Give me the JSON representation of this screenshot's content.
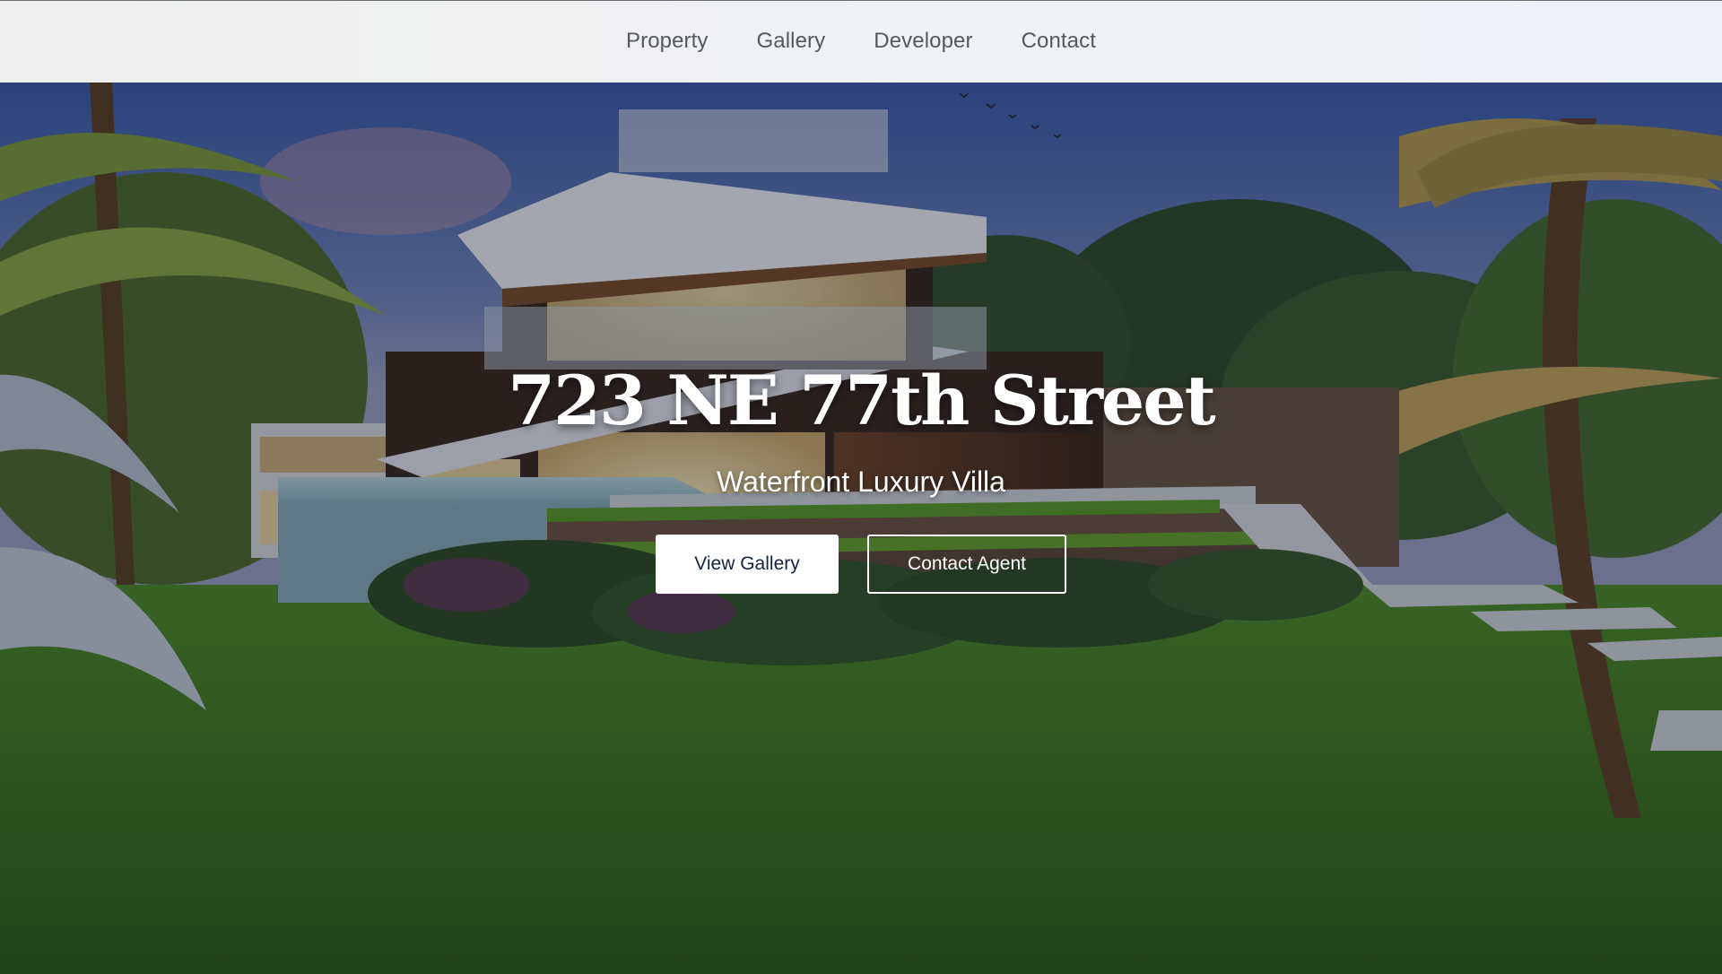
{
  "nav": {
    "links": [
      {
        "label": "Property"
      },
      {
        "label": "Gallery"
      },
      {
        "label": "Developer"
      },
      {
        "label": "Contact"
      }
    ]
  },
  "hero": {
    "title": "723 NE 77th Street",
    "subtitle": "Waterfront Luxury Villa",
    "buttons": {
      "primary_label": "View Gallery",
      "secondary_label": "Contact Agent"
    }
  },
  "colors": {
    "nav_background": "#f0f1f3",
    "nav_text": "#54595f",
    "primary_button_text": "#14243f",
    "hero_text": "#ffffff"
  }
}
